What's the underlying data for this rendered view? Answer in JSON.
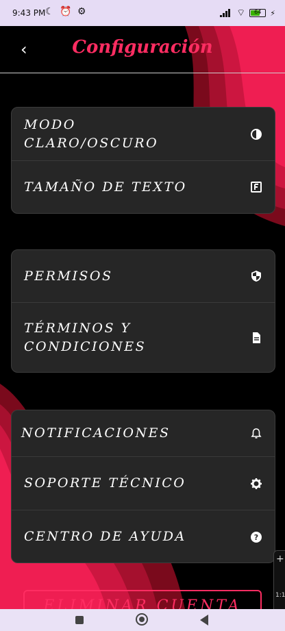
{
  "status_bar": {
    "time": "9:43 PM",
    "battery": "64"
  },
  "header": {
    "back_label": "‹",
    "title": "Configuración"
  },
  "sections": [
    {
      "items": [
        {
          "label": "MODO CLARO/OSCURO",
          "icon": "contrast-icon"
        },
        {
          "label": "TAMAÑO DE TEXTO",
          "icon": "font-size-icon"
        }
      ]
    },
    {
      "items": [
        {
          "label": "PERMISOS",
          "icon": "shield-icon"
        },
        {
          "label": "TÉRMINOS Y CONDICIONES",
          "icon": "document-icon"
        }
      ]
    },
    {
      "items": [
        {
          "label": "NOTIFICACIONES",
          "icon": "bell-icon"
        },
        {
          "label": "SOPORTE TÉCNICO",
          "icon": "gear-icon"
        },
        {
          "label": "CENTRO DE AYUDA",
          "icon": "help-icon"
        }
      ]
    }
  ],
  "danger_button": {
    "label": "ELIMINAR CUENTA"
  },
  "side_tool": {
    "plus": "+",
    "ratio": "1:1"
  },
  "colors": {
    "accent": "#ff2d62",
    "card": "#262626",
    "background": "#000000"
  }
}
